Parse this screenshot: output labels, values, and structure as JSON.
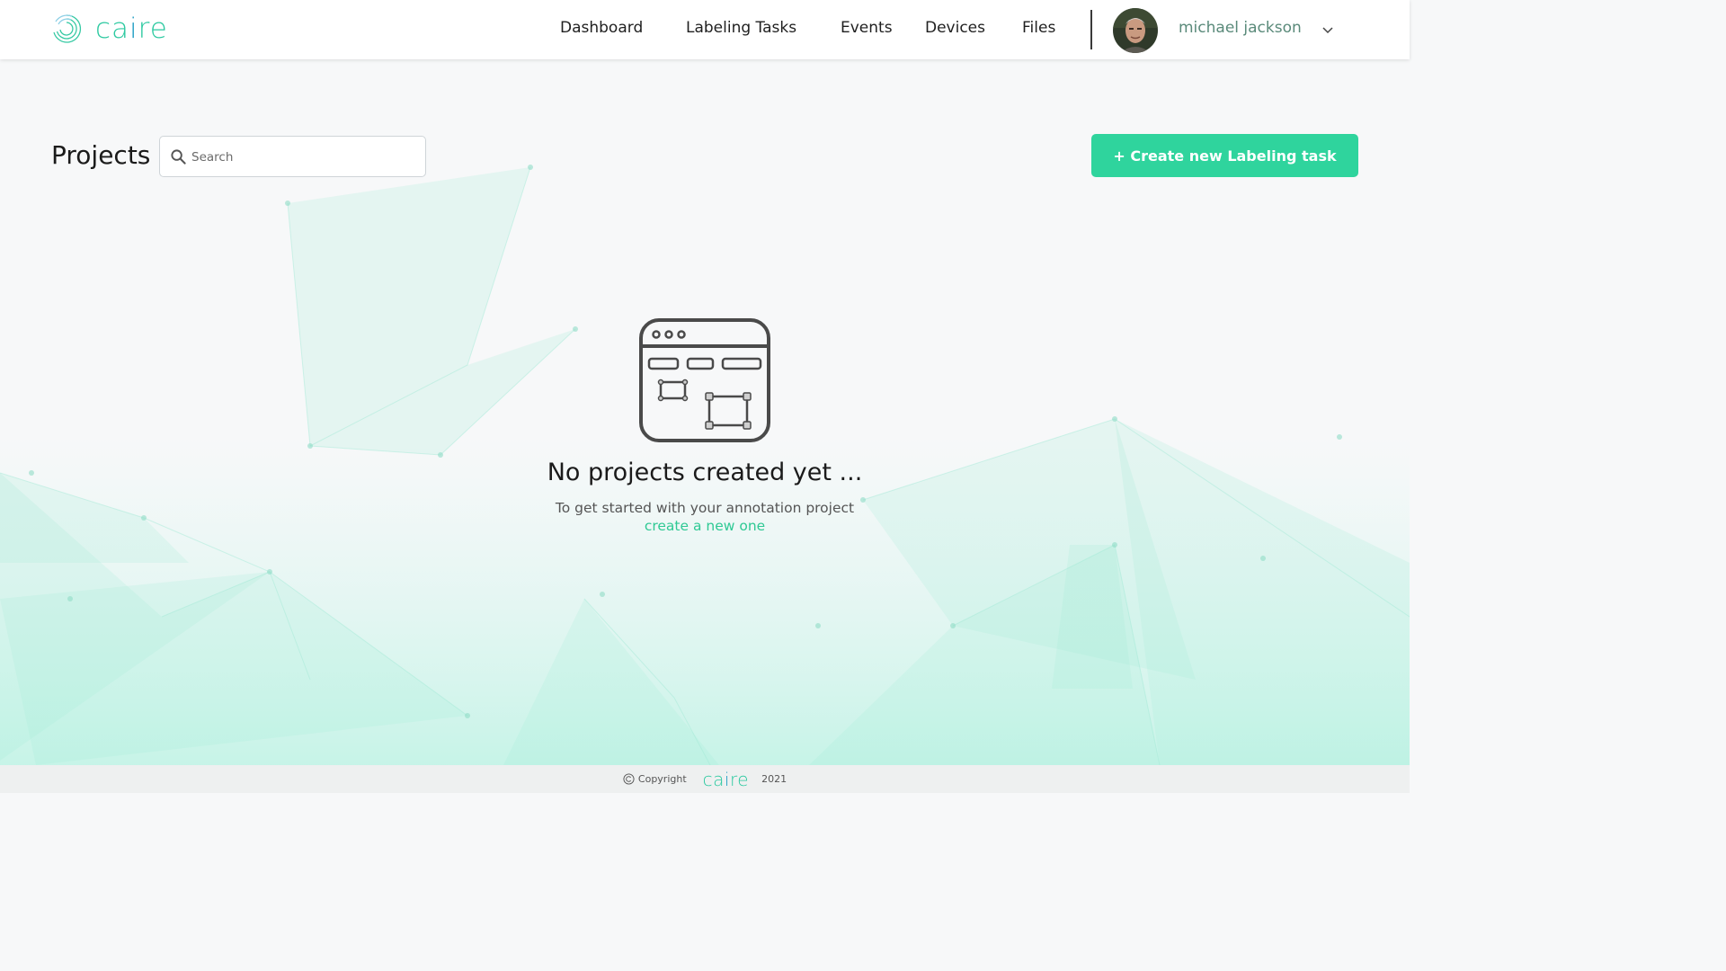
{
  "header": {
    "brand": {
      "c": "ca",
      "i": "i",
      "re": "re"
    },
    "nav": [
      "Dashboard",
      "Labeling Tasks",
      "Events",
      "Devices",
      "Files"
    ],
    "user_name": "michael jackson"
  },
  "main": {
    "title": "Projects",
    "search_placeholder": "Search",
    "create_button": "+ Create new Labeling task",
    "empty_title": "No projects created yet ...",
    "empty_subtitle": "To get started with your annotation project",
    "empty_link": "create a new one"
  },
  "footer": {
    "copyright_label": "Copyright",
    "brand": {
      "c": "ca",
      "i": "i",
      "re": "re"
    },
    "year": "2021"
  },
  "colors": {
    "accent": "#2fd49d",
    "link": "#2fc994",
    "brand_teal": "#2cc9a0",
    "brand_blue": "#1d9cc4",
    "user_name": "#5a8a7a"
  },
  "icons": [
    "caire-swirl-logo",
    "search-icon",
    "chevron-down-icon",
    "copyright-icon",
    "empty-browser-illustration"
  ]
}
